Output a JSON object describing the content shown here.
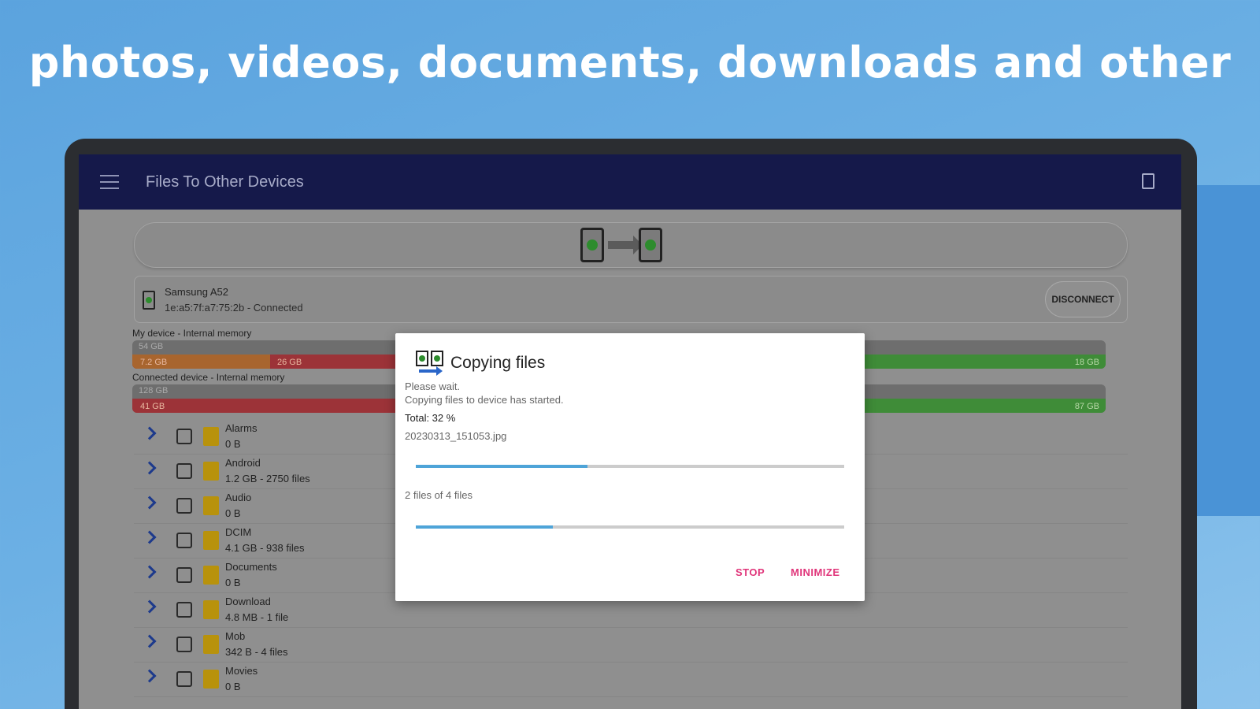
{
  "headline": "photos, videos, documents, downloads and other",
  "app": {
    "title": "Files To Other Devices"
  },
  "device": {
    "name": "Samsung A52",
    "status": "1e:a5:7f:a7:75:2b - Connected",
    "disconnect_label": "DISCONNECT"
  },
  "memory": {
    "my_device": {
      "label": "My device - Internal memory",
      "total": "54 GB",
      "seg1": "7.2 GB",
      "seg2": "26 GB",
      "free": "18 GB",
      "used_fraction": 0.67
    },
    "connected_device": {
      "label": "Connected device - Internal memory",
      "total": "128 GB",
      "seg1": "41 GB",
      "free": "87 GB",
      "used_fraction": 0.32
    }
  },
  "folders": [
    {
      "name": "Alarms",
      "info": "0 B"
    },
    {
      "name": "Android",
      "info": "1.2 GB - 2750 files"
    },
    {
      "name": "Audio",
      "info": "0 B"
    },
    {
      "name": "DCIM",
      "info": "4.1 GB - 938 files"
    },
    {
      "name": "Documents",
      "info": "0 B"
    },
    {
      "name": "Download",
      "info": "4.8 MB - 1 file"
    },
    {
      "name": "Mob",
      "info": "342 B - 4 files"
    },
    {
      "name": "Movies",
      "info": "0 B"
    }
  ],
  "dialog": {
    "title": "Copying files",
    "line1": "Please wait.",
    "line2": "Copying files to device has started.",
    "total": "Total: 32 %",
    "current_file": "20230313_151053.jpg",
    "file_progress": 0.4,
    "count_text": "2 files of 4 files",
    "count_progress": 0.32,
    "stop_label": "STOP",
    "minimize_label": "MINIMIZE"
  },
  "colors": {
    "appbar": "#15194a",
    "accent": "#e0357a",
    "progress": "#4ea4d8"
  }
}
